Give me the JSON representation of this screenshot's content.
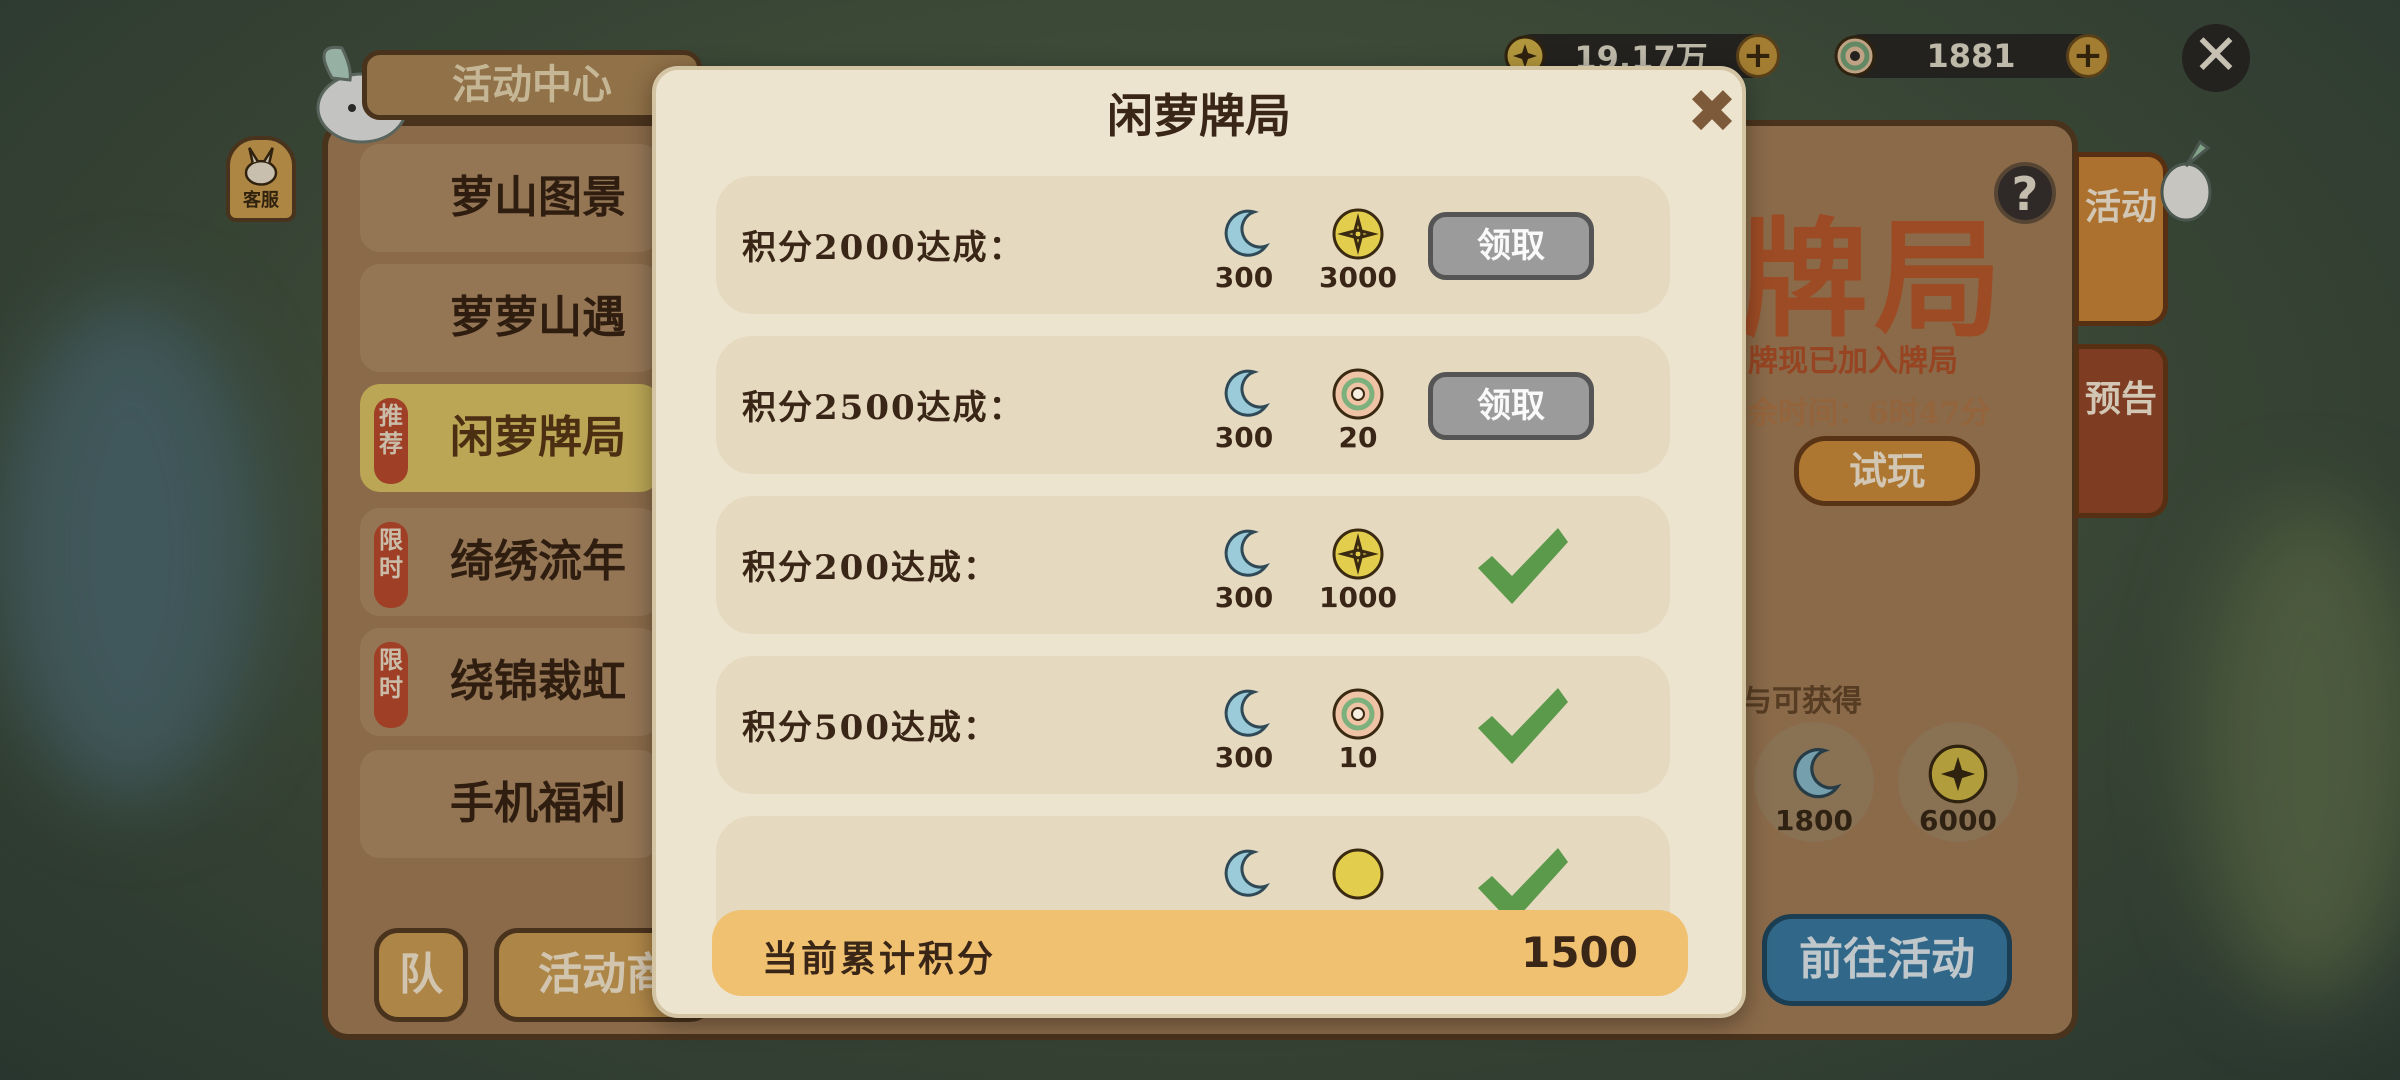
{
  "top_bar": {
    "gold_amount": "19.17万",
    "coin_amount": "1881"
  },
  "background": {
    "panel_title": "活动中心",
    "service_label": "客服",
    "sidebar": [
      {
        "label": "萝山图景",
        "badge": "",
        "active": false
      },
      {
        "label": "萝萝山遇",
        "badge": "",
        "active": false
      },
      {
        "label": "闲萝牌局",
        "badge": "推荐",
        "active": true
      },
      {
        "label": "绮绣流年",
        "badge": "限时",
        "active": false
      },
      {
        "label": "绕锦裁虹",
        "badge": "限时",
        "active": false
      },
      {
        "label": "手机福利",
        "badge": "",
        "active": false
      }
    ],
    "bottom_buttons": {
      "team": "队",
      "shop": "活动商"
    },
    "detail": {
      "title_fragment": "牌局",
      "line1": "牌现已加入牌局",
      "line2": "余时间：6时47分",
      "trial_button": "试玩",
      "rewards_caption": "与可获得",
      "rewards": [
        {
          "icon": "moon-icon",
          "amount": "1800"
        },
        {
          "icon": "gold-coin-icon",
          "amount": "6000"
        }
      ],
      "goto_button": "前往活动"
    },
    "right_tabs": [
      "活动",
      "预告"
    ]
  },
  "modal": {
    "title": "闲萝牌局",
    "rows": [
      {
        "label": "积分2000达成：",
        "rewards": [
          {
            "icon": "moon-icon",
            "amount": "300"
          },
          {
            "icon": "gold-coin-icon",
            "amount": "3000"
          }
        ],
        "status": "claim",
        "claim_label": "领取"
      },
      {
        "label": "积分2500达成：",
        "rewards": [
          {
            "icon": "moon-icon",
            "amount": "300"
          },
          {
            "icon": "jade-coin-icon",
            "amount": "20"
          }
        ],
        "status": "claim",
        "claim_label": "领取"
      },
      {
        "label": "积分200达成：",
        "rewards": [
          {
            "icon": "moon-icon",
            "amount": "300"
          },
          {
            "icon": "gold-coin-icon",
            "amount": "1000"
          }
        ],
        "status": "done"
      },
      {
        "label": "积分500达成：",
        "rewards": [
          {
            "icon": "moon-icon",
            "amount": "300"
          },
          {
            "icon": "jade-coin-icon",
            "amount": "10"
          }
        ],
        "status": "done"
      },
      {
        "label": "",
        "rewards": [
          {
            "icon": "moon-icon",
            "amount": ""
          },
          {
            "icon": "gold-coin-icon",
            "amount": ""
          }
        ],
        "status": "done"
      }
    ],
    "score_label": "当前累计积分",
    "score_value": "1500"
  },
  "colors": {
    "modal_bg": "#ede4cf",
    "row_bg": "#e5d9c0",
    "score_bar": "#f0c171",
    "check_green": "#5a9a4a",
    "claim_gray": "#9b9b9b"
  }
}
